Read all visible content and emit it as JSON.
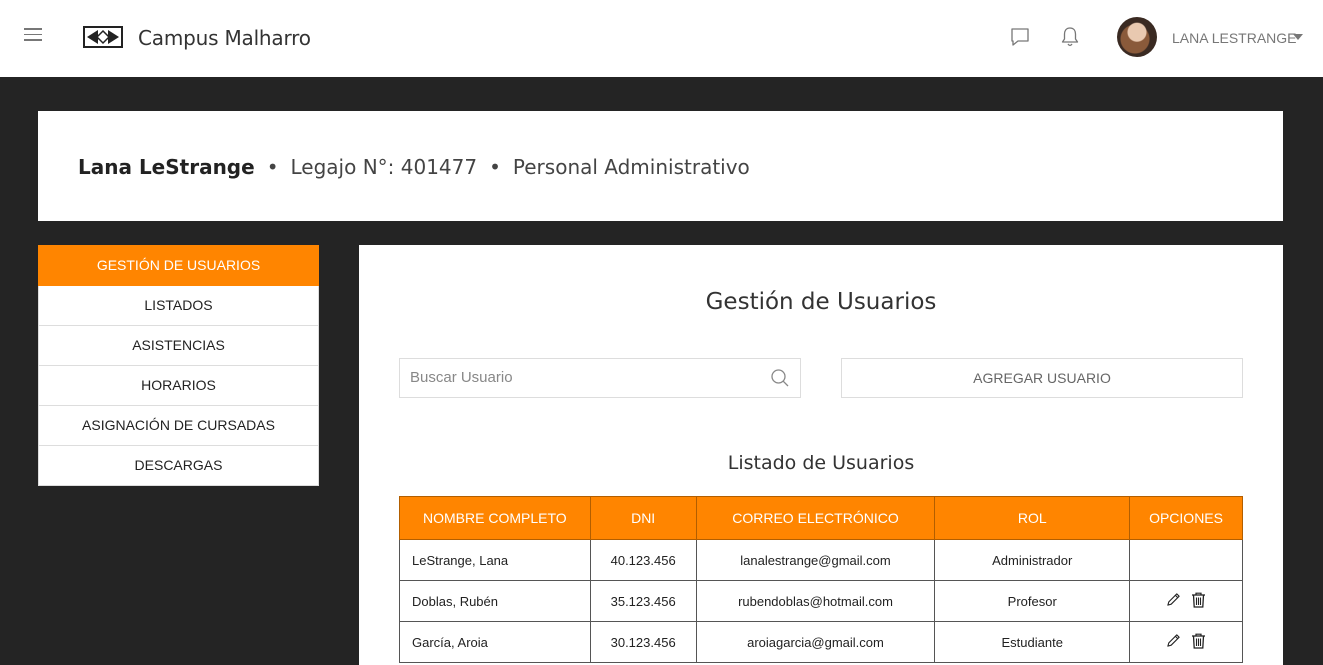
{
  "app": {
    "title": "Campus Malharro"
  },
  "header": {
    "user_name": "LANA LESTRANGE",
    "icons": [
      "menu-icon",
      "logo-icon",
      "chat-icon",
      "bell-icon",
      "avatar",
      "chevron-down-icon"
    ]
  },
  "profile": {
    "name": "Lana LeStrange",
    "separator": "•",
    "legajo": "Legajo N°: 401477",
    "role": "Personal Administrativo"
  },
  "sidebar": {
    "items": [
      {
        "label": "GESTIÓN DE USUARIOS",
        "active": true
      },
      {
        "label": "LISTADOS"
      },
      {
        "label": "ASISTENCIAS"
      },
      {
        "label": "HORARIOS"
      },
      {
        "label": "ASIGNACIÓN DE CURSADAS"
      },
      {
        "label": "DESCARGAS"
      }
    ]
  },
  "main": {
    "title": "Gestión de Usuarios",
    "search": {
      "placeholder": "Buscar Usuario",
      "value": ""
    },
    "add_button": "AGREGAR USUARIO",
    "list_title": "Listado de Usuarios",
    "table": {
      "columns": [
        "NOMBRE COMPLETO",
        "DNI",
        "CORREO ELECTRÓNICO",
        "ROL",
        "OPCIONES"
      ],
      "rows": [
        {
          "name": "LeStrange, Lana",
          "dni": "40.123.456",
          "email": "lanalestrange@gmail.com",
          "role": "Administrador",
          "options": []
        },
        {
          "name": "Doblas, Rubén",
          "dni": "35.123.456",
          "email": "rubendoblas@hotmail.com",
          "role": "Profesor",
          "options": [
            "pencil-icon",
            "trash-icon"
          ]
        },
        {
          "name": "García, Aroia",
          "dni": "30.123.456",
          "email": "aroiagarcia@gmail.com",
          "role": "Estudiante",
          "options": [
            "pencil-icon",
            "trash-icon"
          ]
        }
      ]
    }
  },
  "colors": {
    "accent": "#ff8500",
    "background": "#242424",
    "card": "#ffffff"
  }
}
